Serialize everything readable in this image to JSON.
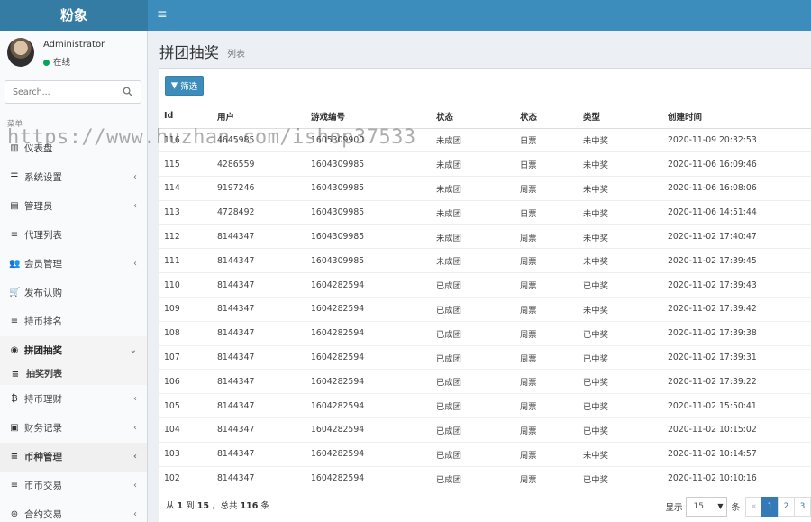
{
  "app": {
    "logo": "粉象"
  },
  "user": {
    "name": "Administrator",
    "status": "在线"
  },
  "search": {
    "placeholder": "Search..."
  },
  "menu_header": "菜单",
  "menu": [
    {
      "label": "仪表盘",
      "icon": "bar-chart-icon",
      "glyph": "▥",
      "chevron": ""
    },
    {
      "label": "系统设置",
      "icon": "sliders-icon",
      "glyph": "☰",
      "chevron": "‹"
    },
    {
      "label": "管理员",
      "icon": "id-card-icon",
      "glyph": "▤",
      "chevron": "‹"
    },
    {
      "label": "代理列表",
      "icon": "list-icon",
      "glyph": "≡",
      "chevron": ""
    },
    {
      "label": "会员管理",
      "icon": "users-icon",
      "glyph": "👥",
      "chevron": "‹"
    },
    {
      "label": "发布认购",
      "icon": "cart-icon",
      "glyph": "🛒",
      "chevron": ""
    },
    {
      "label": "持币排名",
      "icon": "list-icon",
      "glyph": "≡",
      "chevron": ""
    },
    {
      "label": "拼团抽奖",
      "icon": "gamepad-icon",
      "glyph": "◉",
      "chevron": "⌄"
    },
    {
      "label": "抽奖列表",
      "icon": "list-icon",
      "glyph": "≡",
      "chevron": ""
    },
    {
      "label": "持币理财",
      "icon": "bitcoin-icon",
      "glyph": "₿",
      "chevron": "‹"
    },
    {
      "label": "财务记录",
      "icon": "money-icon",
      "glyph": "▣",
      "chevron": "‹"
    },
    {
      "label": "币种管理",
      "icon": "list-icon",
      "glyph": "≡",
      "chevron": "‹"
    },
    {
      "label": "币币交易",
      "icon": "list-icon",
      "glyph": "≡",
      "chevron": "‹"
    },
    {
      "label": "合约交易",
      "icon": "tags-icon",
      "glyph": "⊛",
      "chevron": "‹"
    }
  ],
  "page": {
    "title": "拼团抽奖",
    "subtitle": "列表"
  },
  "toolbar": {
    "filter_label": "筛选"
  },
  "table": {
    "columns": [
      "Id",
      "用户",
      "游戏编号",
      "状态",
      "状态",
      "类型",
      "创建时间"
    ],
    "rows": [
      [
        "116",
        "4645985",
        "1605309900",
        "未成团",
        "日票",
        "未中奖",
        "2020-11-09 20:32:53"
      ],
      [
        "115",
        "4286559",
        "1604309985",
        "未成团",
        "日票",
        "未中奖",
        "2020-11-06 16:09:46"
      ],
      [
        "114",
        "9197246",
        "1604309985",
        "未成团",
        "周票",
        "未中奖",
        "2020-11-06 16:08:06"
      ],
      [
        "113",
        "4728492",
        "1604309985",
        "未成团",
        "日票",
        "未中奖",
        "2020-11-06 14:51:44"
      ],
      [
        "112",
        "8144347",
        "1604309985",
        "未成团",
        "周票",
        "未中奖",
        "2020-11-02 17:40:47"
      ],
      [
        "111",
        "8144347",
        "1604309985",
        "未成团",
        "周票",
        "未中奖",
        "2020-11-02 17:39:45"
      ],
      [
        "110",
        "8144347",
        "1604282594",
        "已成团",
        "周票",
        "已中奖",
        "2020-11-02 17:39:43"
      ],
      [
        "109",
        "8144347",
        "1604282594",
        "已成团",
        "周票",
        "未中奖",
        "2020-11-02 17:39:42"
      ],
      [
        "108",
        "8144347",
        "1604282594",
        "已成团",
        "周票",
        "已中奖",
        "2020-11-02 17:39:38"
      ],
      [
        "107",
        "8144347",
        "1604282594",
        "已成团",
        "周票",
        "已中奖",
        "2020-11-02 17:39:31"
      ],
      [
        "106",
        "8144347",
        "1604282594",
        "已成团",
        "周票",
        "已中奖",
        "2020-11-02 17:39:22"
      ],
      [
        "105",
        "8144347",
        "1604282594",
        "已成团",
        "周票",
        "已中奖",
        "2020-11-02 15:50:41"
      ],
      [
        "104",
        "8144347",
        "1604282594",
        "已成团",
        "周票",
        "已中奖",
        "2020-11-02 10:15:02"
      ],
      [
        "103",
        "8144347",
        "1604282594",
        "已成团",
        "周票",
        "未中奖",
        "2020-11-02 10:14:57"
      ],
      [
        "102",
        "8144347",
        "1604282594",
        "已成团",
        "周票",
        "已中奖",
        "2020-11-02 10:10:16"
      ]
    ]
  },
  "footer": {
    "prefix": "从",
    "from": "1",
    "to_word": "到",
    "to": "15",
    "total_prefix": "，总共",
    "total": "116",
    "total_suffix": "条"
  },
  "pagination": {
    "show_label": "显示",
    "page_size": "15",
    "unit": "条",
    "prev": "«",
    "pages": [
      "1",
      "2",
      "3"
    ],
    "current": "1"
  },
  "watermark": "https://www.huzhan.com/ishop37533",
  "colors": {
    "topbar": "#3c8dbc",
    "logo_bg": "#357ca5",
    "online": "#00a65a",
    "primary": "#337ab7"
  }
}
